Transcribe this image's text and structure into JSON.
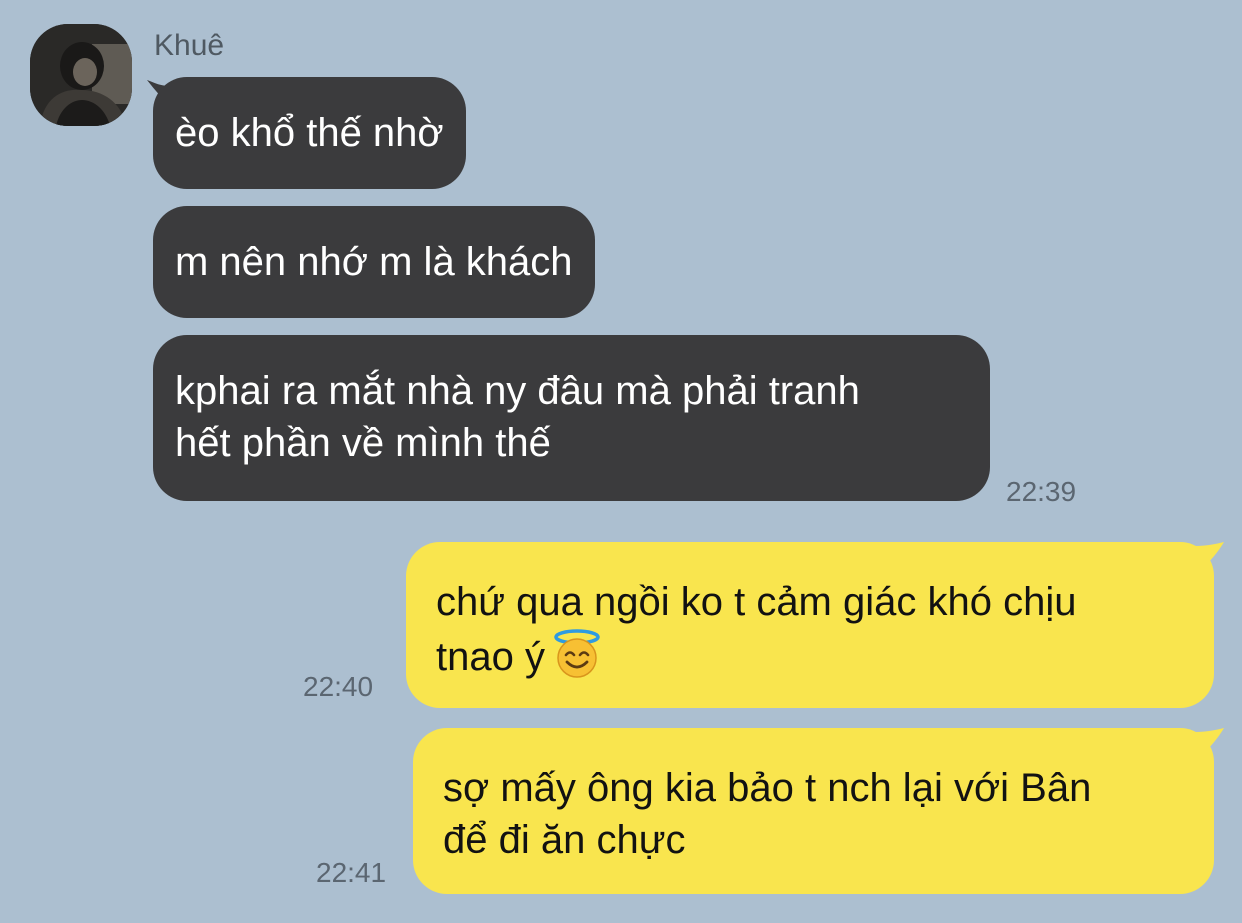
{
  "chat": {
    "sender_name": "Khuê",
    "messages": [
      {
        "direction": "incoming",
        "lines": [
          "èo khổ thế nhờ"
        ]
      },
      {
        "direction": "incoming",
        "lines": [
          "m nên nhớ m là khách"
        ]
      },
      {
        "direction": "incoming",
        "lines": [
          "kphai ra mắt nhà ny đâu mà phải tranh",
          "hết phần về mình thế"
        ],
        "time": "22:39"
      },
      {
        "direction": "outgoing",
        "lines": [
          "chứ qua ngồi ko t cảm giác khó chịu",
          "tnao ý"
        ],
        "emoji": "smiling-face-with-halo",
        "time": "22:40"
      },
      {
        "direction": "outgoing",
        "lines": [
          "sợ mấy ông kia bảo t nch lại với Bân",
          "để đi ăn chực"
        ],
        "time": "22:41"
      }
    ]
  },
  "colors": {
    "background": "#acbfd0",
    "incoming_bubble": "#3b3b3d",
    "outgoing_bubble": "#f9e54e"
  }
}
